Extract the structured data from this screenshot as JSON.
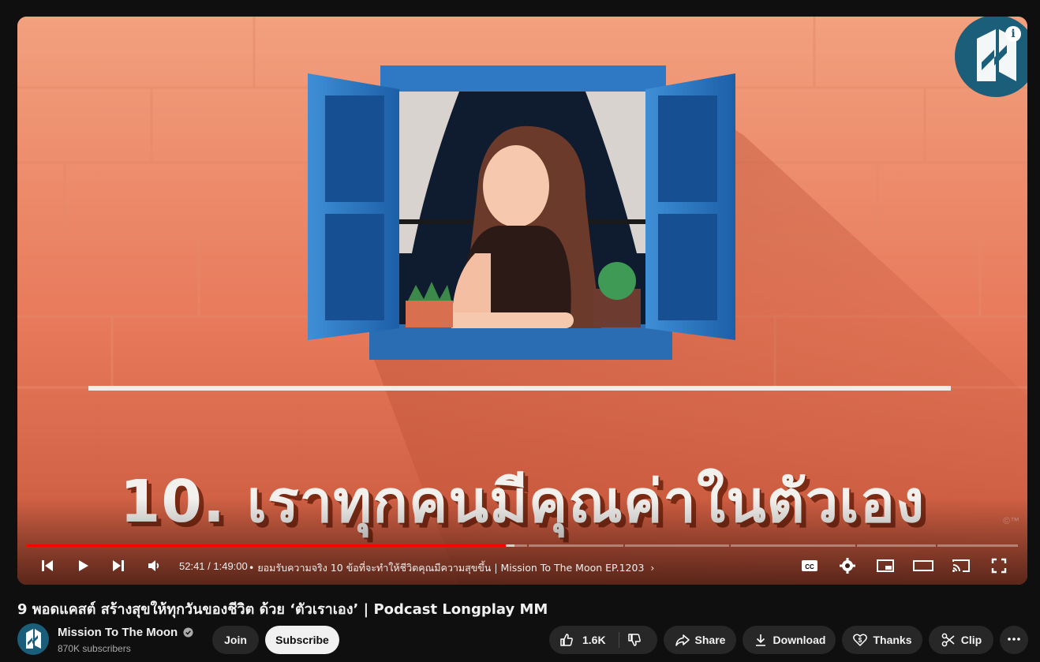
{
  "video": {
    "caption": "10. เราทุกคนมีคุณค่าในตัวเอง",
    "watermark": "©™",
    "info_label": "i",
    "current_time": "52:41",
    "duration": "1:49:00",
    "time_display": "52:41 / 1:49:00",
    "chapter": "• ยอมรับความจริง 10 ข้อที่จะทำให้ชีวิตคุณมีความสุขขึ้น | Mission To The Moon EP.1203",
    "progress_fraction": 0.483,
    "buffered_fraction": 0.492,
    "controls": [
      "previous-icon",
      "play-icon",
      "next-icon",
      "volume-icon",
      "cc-icon",
      "settings-icon",
      "miniplayer-icon",
      "theater-icon",
      "cast-icon",
      "fullscreen-icon"
    ],
    "accent_color": "#ff0000"
  },
  "title": "9 พอดแคสต์ สร้างสุขให้ทุกวันของชีวิต ด้วย ‘ตัวเราเอง’ | Podcast Longplay MM",
  "channel": {
    "name": "Mission To The Moon",
    "subscribers": "870K subscribers",
    "verified": true
  },
  "actions": {
    "join": "Join",
    "subscribe": "Subscribe",
    "likes": "1.6K",
    "share": "Share",
    "download": "Download",
    "thanks": "Thanks",
    "clip": "Clip",
    "more": "more-icon"
  }
}
